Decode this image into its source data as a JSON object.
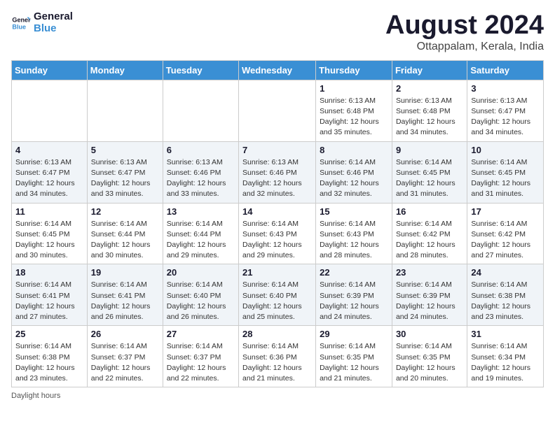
{
  "logo": {
    "line1": "General",
    "line2": "Blue"
  },
  "title": "August 2024",
  "subtitle": "Ottappalam, Kerala, India",
  "days_of_week": [
    "Sunday",
    "Monday",
    "Tuesday",
    "Wednesday",
    "Thursday",
    "Friday",
    "Saturday"
  ],
  "weeks": [
    [
      {
        "day": "",
        "info": ""
      },
      {
        "day": "",
        "info": ""
      },
      {
        "day": "",
        "info": ""
      },
      {
        "day": "",
        "info": ""
      },
      {
        "day": "1",
        "info": "Sunrise: 6:13 AM\nSunset: 6:48 PM\nDaylight: 12 hours and 35 minutes."
      },
      {
        "day": "2",
        "info": "Sunrise: 6:13 AM\nSunset: 6:48 PM\nDaylight: 12 hours and 34 minutes."
      },
      {
        "day": "3",
        "info": "Sunrise: 6:13 AM\nSunset: 6:47 PM\nDaylight: 12 hours and 34 minutes."
      }
    ],
    [
      {
        "day": "4",
        "info": "Sunrise: 6:13 AM\nSunset: 6:47 PM\nDaylight: 12 hours and 34 minutes."
      },
      {
        "day": "5",
        "info": "Sunrise: 6:13 AM\nSunset: 6:47 PM\nDaylight: 12 hours and 33 minutes."
      },
      {
        "day": "6",
        "info": "Sunrise: 6:13 AM\nSunset: 6:46 PM\nDaylight: 12 hours and 33 minutes."
      },
      {
        "day": "7",
        "info": "Sunrise: 6:13 AM\nSunset: 6:46 PM\nDaylight: 12 hours and 32 minutes."
      },
      {
        "day": "8",
        "info": "Sunrise: 6:14 AM\nSunset: 6:46 PM\nDaylight: 12 hours and 32 minutes."
      },
      {
        "day": "9",
        "info": "Sunrise: 6:14 AM\nSunset: 6:45 PM\nDaylight: 12 hours and 31 minutes."
      },
      {
        "day": "10",
        "info": "Sunrise: 6:14 AM\nSunset: 6:45 PM\nDaylight: 12 hours and 31 minutes."
      }
    ],
    [
      {
        "day": "11",
        "info": "Sunrise: 6:14 AM\nSunset: 6:45 PM\nDaylight: 12 hours and 30 minutes."
      },
      {
        "day": "12",
        "info": "Sunrise: 6:14 AM\nSunset: 6:44 PM\nDaylight: 12 hours and 30 minutes."
      },
      {
        "day": "13",
        "info": "Sunrise: 6:14 AM\nSunset: 6:44 PM\nDaylight: 12 hours and 29 minutes."
      },
      {
        "day": "14",
        "info": "Sunrise: 6:14 AM\nSunset: 6:43 PM\nDaylight: 12 hours and 29 minutes."
      },
      {
        "day": "15",
        "info": "Sunrise: 6:14 AM\nSunset: 6:43 PM\nDaylight: 12 hours and 28 minutes."
      },
      {
        "day": "16",
        "info": "Sunrise: 6:14 AM\nSunset: 6:42 PM\nDaylight: 12 hours and 28 minutes."
      },
      {
        "day": "17",
        "info": "Sunrise: 6:14 AM\nSunset: 6:42 PM\nDaylight: 12 hours and 27 minutes."
      }
    ],
    [
      {
        "day": "18",
        "info": "Sunrise: 6:14 AM\nSunset: 6:41 PM\nDaylight: 12 hours and 27 minutes."
      },
      {
        "day": "19",
        "info": "Sunrise: 6:14 AM\nSunset: 6:41 PM\nDaylight: 12 hours and 26 minutes."
      },
      {
        "day": "20",
        "info": "Sunrise: 6:14 AM\nSunset: 6:40 PM\nDaylight: 12 hours and 26 minutes."
      },
      {
        "day": "21",
        "info": "Sunrise: 6:14 AM\nSunset: 6:40 PM\nDaylight: 12 hours and 25 minutes."
      },
      {
        "day": "22",
        "info": "Sunrise: 6:14 AM\nSunset: 6:39 PM\nDaylight: 12 hours and 24 minutes."
      },
      {
        "day": "23",
        "info": "Sunrise: 6:14 AM\nSunset: 6:39 PM\nDaylight: 12 hours and 24 minutes."
      },
      {
        "day": "24",
        "info": "Sunrise: 6:14 AM\nSunset: 6:38 PM\nDaylight: 12 hours and 23 minutes."
      }
    ],
    [
      {
        "day": "25",
        "info": "Sunrise: 6:14 AM\nSunset: 6:38 PM\nDaylight: 12 hours and 23 minutes."
      },
      {
        "day": "26",
        "info": "Sunrise: 6:14 AM\nSunset: 6:37 PM\nDaylight: 12 hours and 22 minutes."
      },
      {
        "day": "27",
        "info": "Sunrise: 6:14 AM\nSunset: 6:37 PM\nDaylight: 12 hours and 22 minutes."
      },
      {
        "day": "28",
        "info": "Sunrise: 6:14 AM\nSunset: 6:36 PM\nDaylight: 12 hours and 21 minutes."
      },
      {
        "day": "29",
        "info": "Sunrise: 6:14 AM\nSunset: 6:35 PM\nDaylight: 12 hours and 21 minutes."
      },
      {
        "day": "30",
        "info": "Sunrise: 6:14 AM\nSunset: 6:35 PM\nDaylight: 12 hours and 20 minutes."
      },
      {
        "day": "31",
        "info": "Sunrise: 6:14 AM\nSunset: 6:34 PM\nDaylight: 12 hours and 19 minutes."
      }
    ]
  ],
  "footer": "Daylight hours"
}
